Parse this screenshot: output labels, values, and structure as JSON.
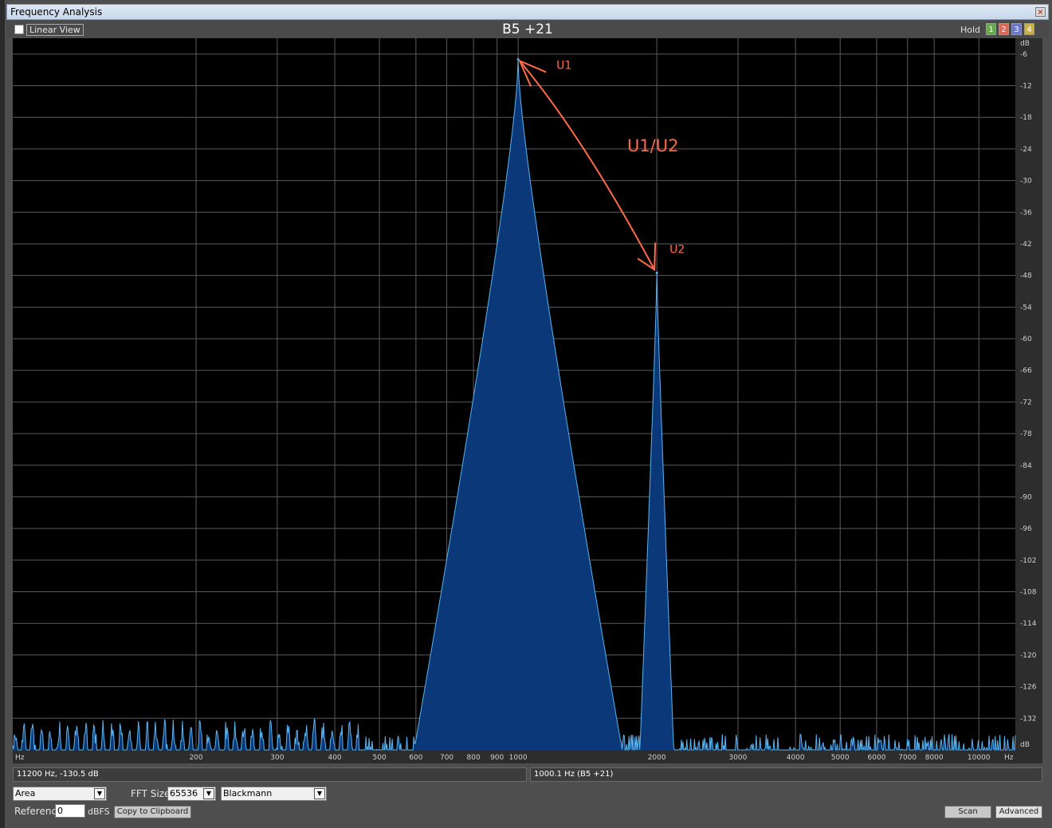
{
  "window": {
    "title": "Frequency Analysis",
    "close_glyph": "×"
  },
  "toolbar": {
    "linear_view_label": "Linear View",
    "linear_view_checked": false,
    "chart_title": "B5 +21",
    "hold_label": "Hold",
    "hold_buttons": [
      {
        "label": "1",
        "color": "#6aa84f"
      },
      {
        "label": "2",
        "color": "#d96a5a"
      },
      {
        "label": "3",
        "color": "#6a78c8"
      },
      {
        "label": "4",
        "color": "#c8b04a"
      }
    ]
  },
  "chart_data": {
    "type": "area",
    "title": "B5 +21",
    "x_scale": "log",
    "xlim": [
      80,
      12000
    ],
    "ylim": [
      -138,
      -3
    ],
    "grid": true,
    "x_tick_labels": [
      {
        "value": 80,
        "label": "Hz"
      },
      {
        "value": 200,
        "label": "200"
      },
      {
        "value": 300,
        "label": "300"
      },
      {
        "value": 400,
        "label": "400"
      },
      {
        "value": 500,
        "label": "500"
      },
      {
        "value": 600,
        "label": "600"
      },
      {
        "value": 700,
        "label": "700"
      },
      {
        "value": 800,
        "label": "800"
      },
      {
        "value": 900,
        "label": "900"
      },
      {
        "value": 1000,
        "label": "1000"
      },
      {
        "value": 2000,
        "label": "2000"
      },
      {
        "value": 3000,
        "label": "3000"
      },
      {
        "value": 4000,
        "label": "4000"
      },
      {
        "value": 5000,
        "label": "5000"
      },
      {
        "value": 6000,
        "label": "6000"
      },
      {
        "value": 7000,
        "label": "7000"
      },
      {
        "value": 8000,
        "label": "8000"
      },
      {
        "value": 10000,
        "label": "10000"
      }
    ],
    "x_unit_right": "Hz",
    "y_unit_top": "dB",
    "y_unit_bottom": "dB",
    "y_ticks": [
      -6,
      -12,
      -18,
      -24,
      -30,
      -36,
      -42,
      -48,
      -54,
      -60,
      -66,
      -72,
      -78,
      -84,
      -90,
      -96,
      -102,
      -108,
      -114,
      -120,
      -126,
      -132
    ],
    "noise_floor_db": -133,
    "peaks": [
      {
        "freq": 1000,
        "db": -7,
        "label": "U1"
      },
      {
        "freq": 2000,
        "db": -47.5,
        "label": "U2"
      }
    ],
    "annotations": {
      "u1": "U1",
      "u2": "U2",
      "ratio": "U1/U2"
    },
    "colors": {
      "fill": "#0a3878",
      "line": "#5ab4f0",
      "annotation": "#ff6a4a",
      "grid": "#5a5a5a"
    }
  },
  "status": {
    "cursor_readout": "11200 Hz, -130.5 dB",
    "peak_readout": "1000.1 Hz (B5 +21)"
  },
  "controls": {
    "display_mode": "Area",
    "fft_size_label": "FFT Size",
    "fft_size": "65536",
    "window_function": "Blackmann",
    "reference_label": "Reference",
    "reference_value": "0",
    "reference_unit": "dBFS",
    "copy_button": "Copy to Clipboard",
    "scan_button": "Scan",
    "advanced_button": "Advanced",
    "dropdown_glyph": "▼"
  }
}
